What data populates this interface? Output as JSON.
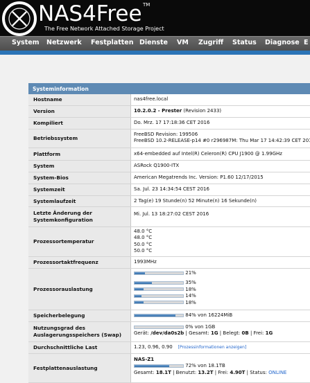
{
  "header": {
    "logo": "NAS4Free",
    "tm": "TM",
    "subtitle": "The Free Network Attached Storage Project"
  },
  "nav": [
    "System",
    "Netzwerk",
    "Festplatten",
    "Dienste",
    "VM",
    "Zugriff",
    "Status",
    "Diagnose",
    "E"
  ],
  "panel": {
    "title": "Systeminformation",
    "hostname": {
      "label": "Hostname",
      "value": "nas4free.local"
    },
    "version": {
      "label": "Version",
      "value_bold": "10.2.0.2 - Prester",
      "value_rest": " (Revision 2433)"
    },
    "compiled": {
      "label": "Kompiliert",
      "value": "Do. Mrz. 17 17:18:36 CET 2016"
    },
    "os": {
      "label": "Betriebssystem",
      "line1": "FreeBSD Revision: 199506",
      "line2": "FreeBSD 10.2-RELEASE-p14 #0 r296987M: Thu Mar 17 14:42:39 CET 201"
    },
    "platform": {
      "label": "Plattform",
      "value": "x64-embedded auf Intel(R) Celeron(R) CPU J1900 @ 1.99GHz"
    },
    "system": {
      "label": "System",
      "value": "ASRock Q1900-ITX"
    },
    "bios": {
      "label": "System-Bios",
      "value": "American Megatrends Inc. Version: P1.60 12/17/2015"
    },
    "systime": {
      "label": "Systemzeit",
      "value": "Sa. Jul. 23 14:34:54 CEST 2016"
    },
    "uptime": {
      "label": "Systemlaufzeit",
      "value": "2 Tag(e) 19 Stunde(n) 52 Minute(n) 16 Sekunde(n)"
    },
    "lastchange": {
      "label": "Letzte Änderung der Systemkonfiguration",
      "value": "Mi. Jul. 13 18:27:02 CEST 2016"
    },
    "cputemp": {
      "label": "Prozessortemperatur",
      "temps": [
        "48.0 °C",
        "48.0 °C",
        "50.0 °C",
        "50.0 °C"
      ]
    },
    "cpufreq": {
      "label": "Prozessortaktfrequenz",
      "value": "1993MHz"
    },
    "cpuload": {
      "label": "Prozessorauslastung",
      "total": {
        "pct": 21,
        "text": "21%"
      },
      "cores": [
        {
          "pct": 35,
          "text": "35%"
        },
        {
          "pct": 18,
          "text": "18%"
        },
        {
          "pct": 14,
          "text": "14%"
        },
        {
          "pct": 18,
          "text": "18%"
        }
      ]
    },
    "memory": {
      "label": "Speicherbelegung",
      "pct": 84,
      "text": "84% von 16224MiB"
    },
    "swap": {
      "label": "Nutzungsgrad des Auslagerungsspeichers (Swap)",
      "pct": 0,
      "text": "0% von 1GB",
      "detail_prefix": "Gerät: ",
      "device": "/dev/da0s2b",
      "total_label": " | Gesamt: ",
      "total": "1G",
      "used_label": " | Belegt: ",
      "used": "0B",
      "free_label": " | Frei: ",
      "free": "1G"
    },
    "loadavg": {
      "label": "Durchschnittliche Last",
      "value": "1.23, 0.96, 0.90",
      "link": "[Prozessinformationen anzeigen]"
    },
    "diskusage": {
      "label": "Festplattenauslastung",
      "pool": "NAS-Z1",
      "pct": 72,
      "text": "72% von 18.1TB",
      "total_label": "Gesamt: ",
      "total": "18.1T",
      "used_label": " | Benutzt: ",
      "used": "13.2T",
      "free_label": " | Frei: ",
      "free": "4.90T",
      "status_label": " | Status: ",
      "status": "ONLINE"
    }
  }
}
